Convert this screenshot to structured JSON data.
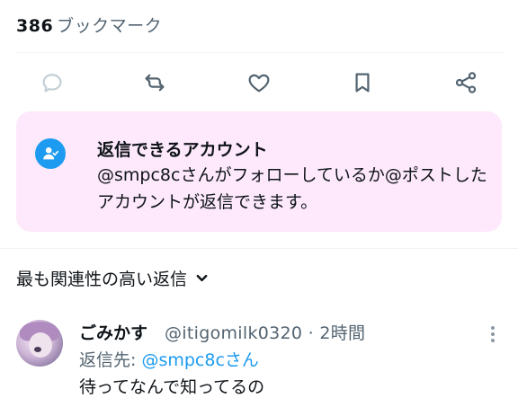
{
  "stats": {
    "count": "386",
    "label": "ブックマーク"
  },
  "actions": [
    {
      "name": "reply-button",
      "icon": "reply-icon"
    },
    {
      "name": "repost-button",
      "icon": "repost-icon"
    },
    {
      "name": "like-button",
      "icon": "heart-icon"
    },
    {
      "name": "bookmark-button",
      "icon": "bookmark-icon"
    },
    {
      "name": "share-button",
      "icon": "share-icon"
    }
  ],
  "notice": {
    "title": "返信できるアカウント",
    "body": "@smpc8cさんがフォローしているか@ポストしたアカウントが返信できます。",
    "accent": "#1d9bf0",
    "background": "#fde9fb"
  },
  "replies_header": {
    "label": "最も関連性の高い返信"
  },
  "reply": {
    "name": "ごみかす",
    "handle": "@itigomilk0320 · 2時間",
    "replying_to_label": "返信先: ",
    "replying_to_mention": "@smpc8cさん",
    "text": "待ってなんで知ってるの"
  }
}
